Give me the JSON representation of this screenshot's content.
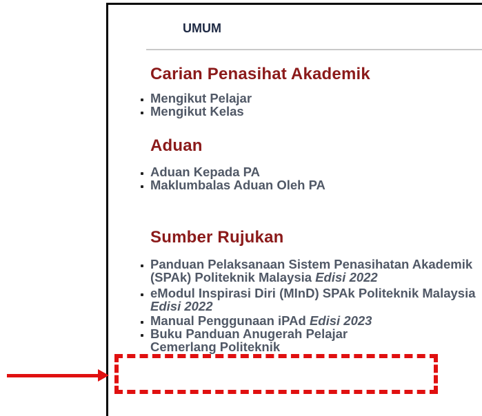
{
  "panel": {
    "title": "UMUM"
  },
  "sections": [
    {
      "heading": "Carian Penasihat Akademik",
      "links": [
        "Mengikut Pelajar",
        "Mengikut Kelas"
      ]
    },
    {
      "heading": "Aduan",
      "links": [
        "Aduan Kepada PA",
        "Maklumbalas Aduan Oleh PA"
      ]
    },
    {
      "heading": "Sumber Rujukan",
      "links": [
        {
          "text": "Panduan Pelaksanaan Sistem Penasihatan Akademik (SPAk) Politeknik Malaysia",
          "edition": "Edisi 2022"
        },
        {
          "text": "eModul Inspirasi Diri (MInD) SPAk Politeknik Malaysia",
          "edition": "Edisi 2022"
        },
        {
          "text": "Manual Penggunaan iPAd",
          "edition": "Edisi 2023"
        },
        {
          "text": "Buku Panduan Anugerah Pelajar Cemerlang Politeknik",
          "edition": ""
        }
      ]
    }
  ],
  "annotation": {
    "color": "#e01010"
  }
}
